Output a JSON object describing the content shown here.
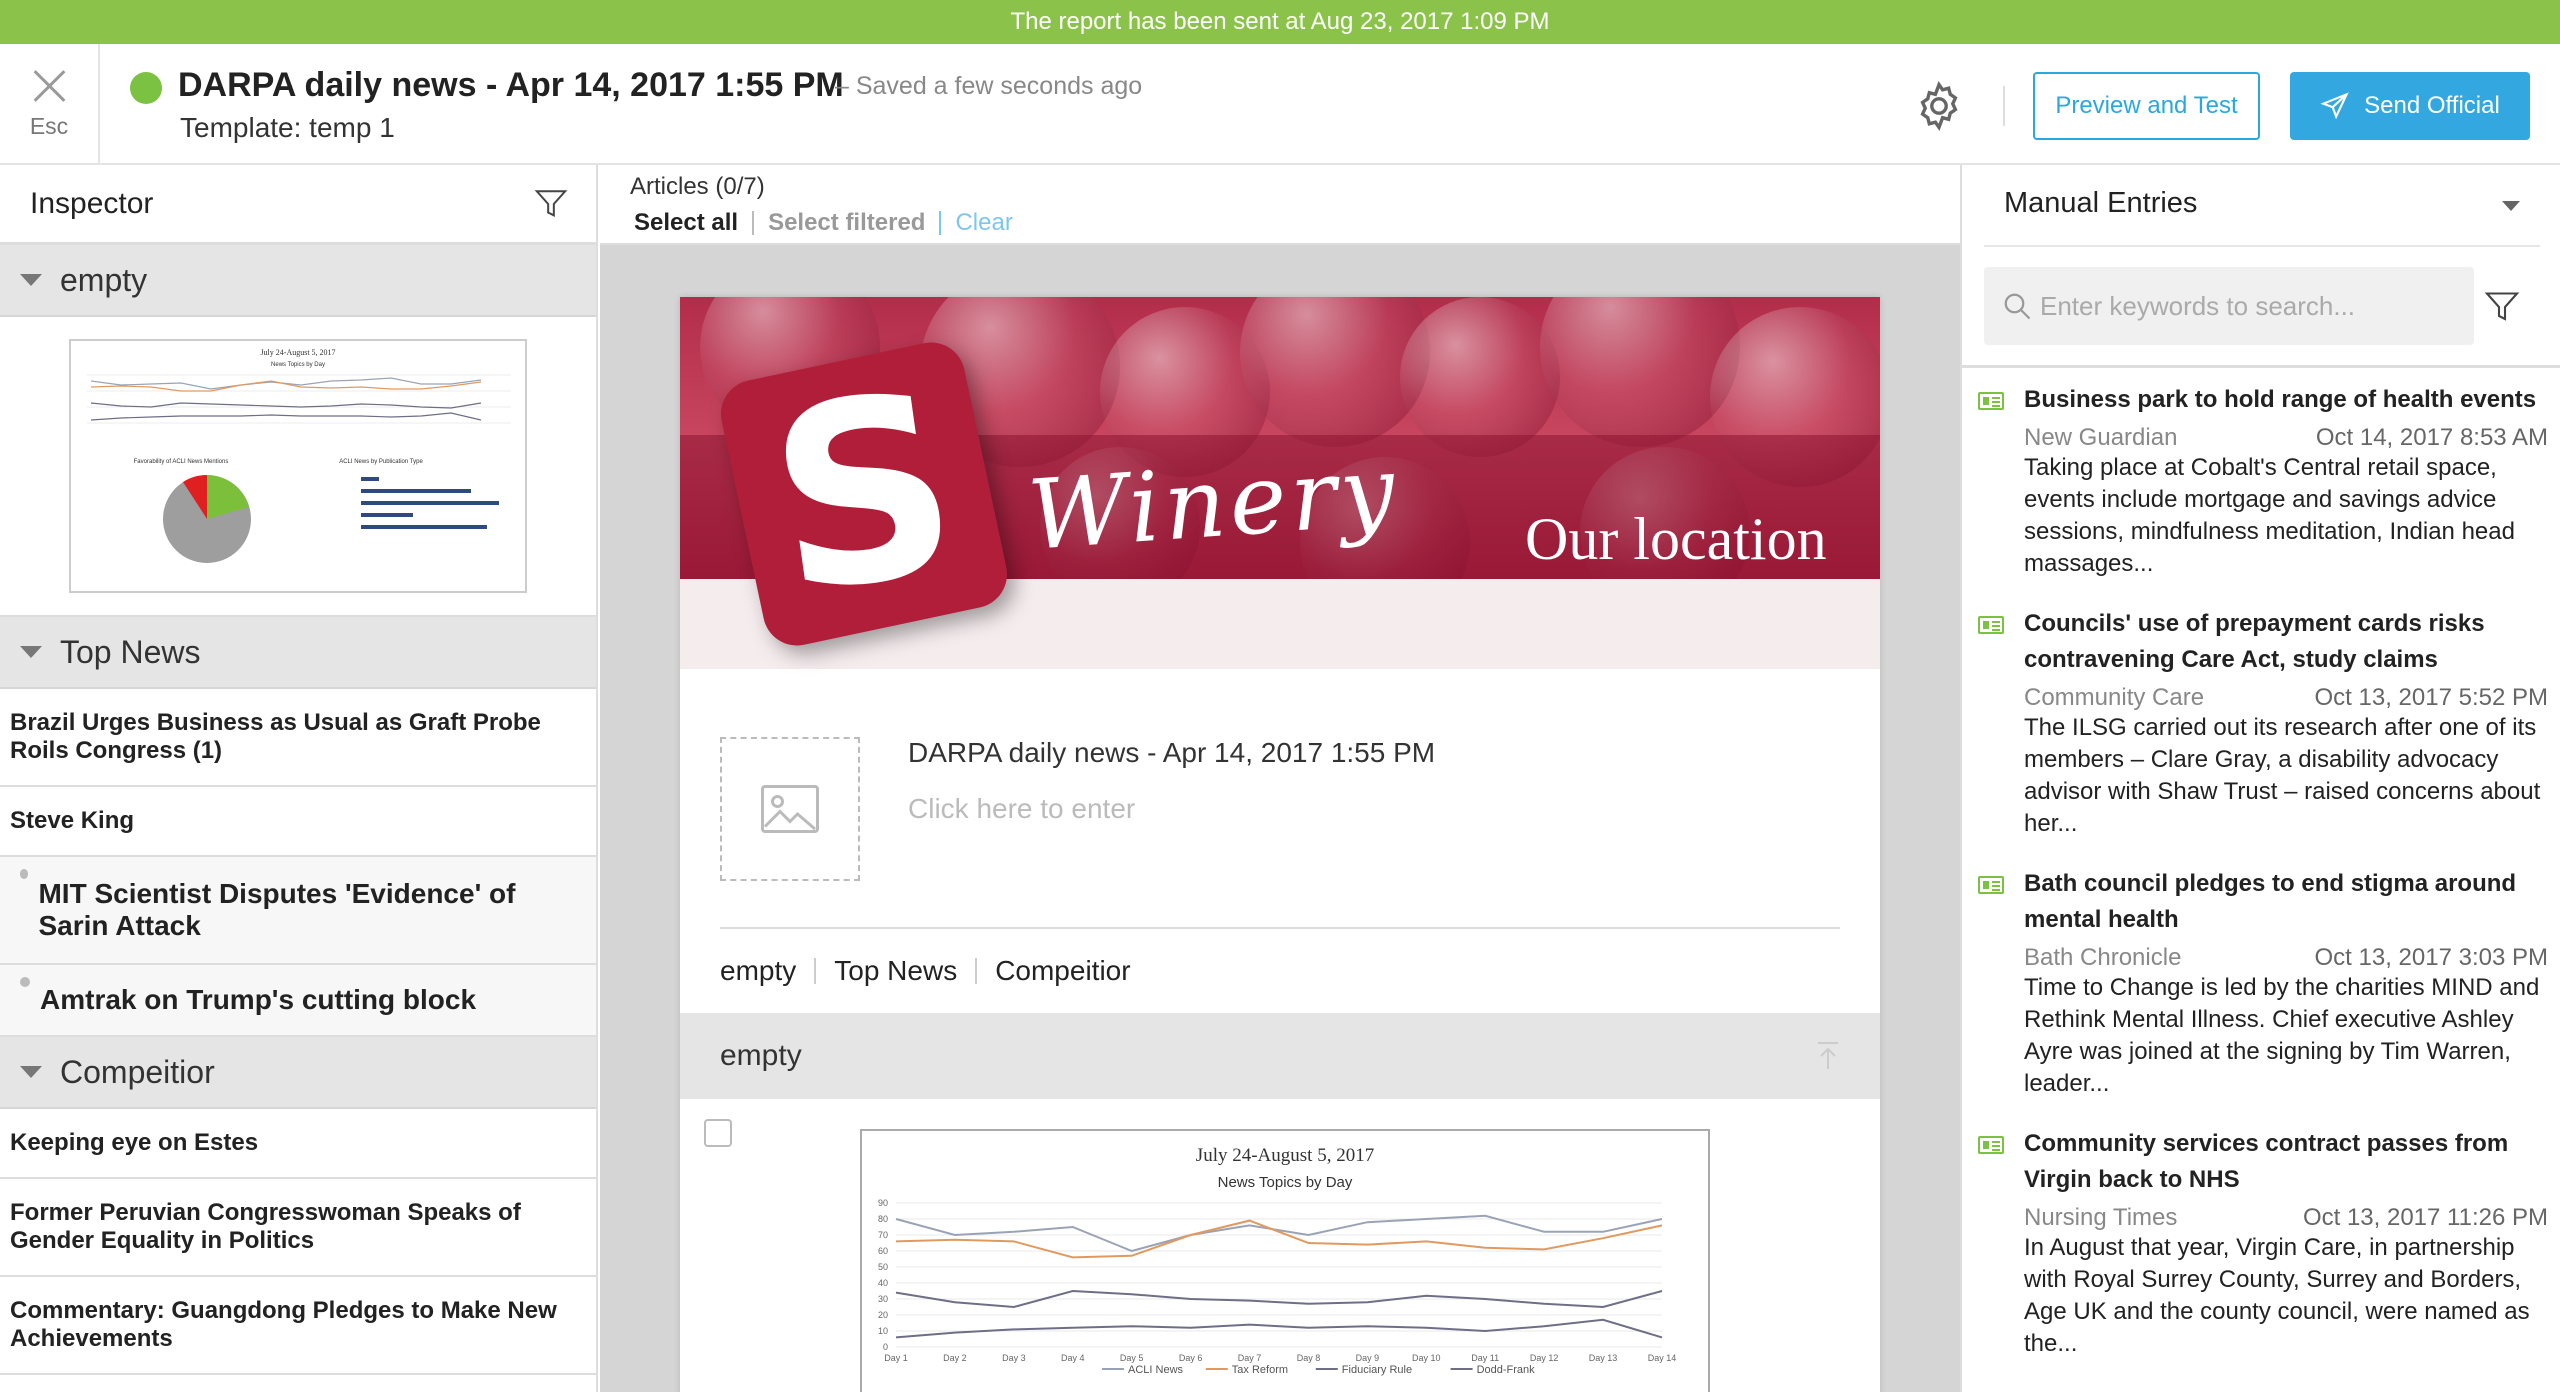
{
  "banner": {
    "text": "The report has been sent at Aug 23, 2017 1:09 PM"
  },
  "header": {
    "esc_label": "Esc",
    "title": "DARPA daily news - Apr 14, 2017 1:55 PM",
    "saved": "–  Saved a few seconds ago",
    "template": "Template: temp 1",
    "preview_label": "Preview and Test",
    "send_label": "Send Official",
    "status_color": "#7cc242"
  },
  "inspector": {
    "title": "Inspector",
    "sections": [
      {
        "label": "empty"
      },
      {
        "label": "Top News",
        "items": [
          "Brazil Urges Business as Usual as Graft Probe Roils Congress (1)",
          "Steve King",
          "MIT Scientist Disputes 'Evidence' of Sarin Attack",
          "Amtrak on Trump's cutting block"
        ]
      },
      {
        "label": "Compeitior",
        "items": [
          "Keeping eye on Estes",
          "Former Peruvian Congresswoman Speaks of Gender Equality in Politics",
          "Commentary: Guangdong Pledges to Make New Achievements"
        ]
      }
    ]
  },
  "articles": {
    "count": "Articles (0/7)",
    "select_all": "Select all",
    "select_filtered": "Select filtered",
    "clear": "Clear"
  },
  "doc": {
    "brand_letter": "S",
    "brand_word": "Winery",
    "banner_caption": "Our location",
    "title": "DARPA daily news - Apr 14, 2017 1:55 PM",
    "click_placeholder": "Click here to enter",
    "nav": [
      "empty",
      "Top News",
      "Compeitior"
    ],
    "section_label": "empty"
  },
  "chart_data": {
    "type": "line",
    "title": "July 24-August 5, 2017",
    "subtitle": "News Topics by Day",
    "categories": [
      "Day 1",
      "Day 2",
      "Day 3",
      "Day 4",
      "Day 5",
      "Day 6",
      "Day 7",
      "Day 8",
      "Day 9",
      "Day 10",
      "Day 11",
      "Day 12",
      "Day 13",
      "Day 14"
    ],
    "ylim": [
      0,
      90
    ],
    "yticks": [
      0,
      10,
      20,
      30,
      40,
      50,
      60,
      70,
      80,
      90
    ],
    "series": [
      {
        "name": "ACLI News",
        "color": "#9aa3b5",
        "values": [
          80,
          70,
          72,
          75,
          60,
          70,
          76,
          70,
          78,
          80,
          82,
          72,
          72,
          80
        ]
      },
      {
        "name": "Tax Reform",
        "color": "#e09a60",
        "values": [
          66,
          67,
          66,
          56,
          57,
          70,
          79,
          65,
          64,
          66,
          62,
          61,
          68,
          76
        ]
      },
      {
        "name": "Fiduciary Rule",
        "color": "#6e6e86",
        "values": [
          34,
          28,
          25,
          35,
          33,
          30,
          29,
          27,
          28,
          32,
          30,
          27,
          25,
          35
        ]
      },
      {
        "name": "Dodd-Frank",
        "color": "#6e6e86",
        "values": [
          6,
          9,
          11,
          12,
          13,
          12,
          14,
          12,
          13,
          12,
          10,
          13,
          17,
          6
        ]
      }
    ],
    "legend": "bottom",
    "next_titles": [
      "Favorability of ACLI News Mentions",
      "ACLI News by Publication Type"
    ]
  },
  "manual_entries": {
    "title": "Manual Entries",
    "search_placeholder": "Enter keywords to search...",
    "entries": [
      {
        "title": "Business park to hold range of health events",
        "source": "New Guardian",
        "date": "Oct 14, 2017 8:53 AM",
        "desc": "Taking place at Cobalt's Central retail space, events include mortgage and savings advice sessions, mindfulness meditation, Indian head massages..."
      },
      {
        "title": "Councils' use of prepayment cards risks contravening Care Act, study claims",
        "source": "Community Care",
        "date": "Oct 13, 2017 5:52 PM",
        "desc": "The ILSG carried out its research after one of its members – Clare Gray, a disability advocacy advisor with Shaw Trust – raised concerns about her..."
      },
      {
        "title": "Bath council pledges to end stigma around mental health",
        "source": "Bath Chronicle",
        "date": "Oct 13, 2017 3:03 PM",
        "desc": "Time to Change is led by the charities MIND and Rethink Mental Illness. Chief executive Ashley Ayre was joined at the signing by Tim Warren, leader..."
      },
      {
        "title": "Community services contract passes from Virgin back to NHS",
        "source": "Nursing Times",
        "date": "Oct 13, 2017 11:26 PM",
        "desc": "In August that year, Virgin Care, in partnership with Royal Surrey County, Surrey and Borders, Age UK and the county council, were named as the..."
      }
    ]
  }
}
